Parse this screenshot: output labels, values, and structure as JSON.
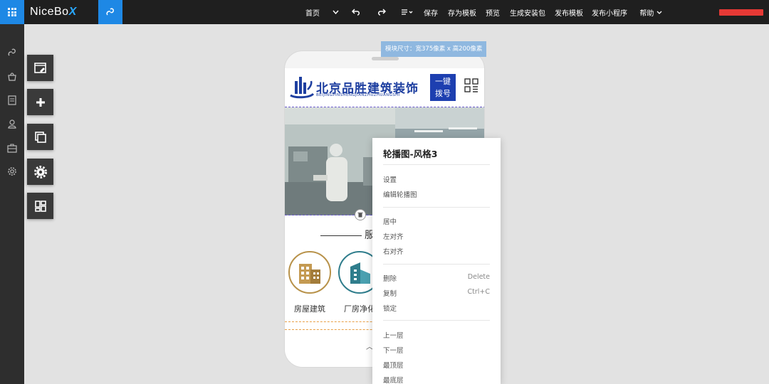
{
  "app": {
    "name_prefix": "NiceBo",
    "name_x": "X"
  },
  "topnav": {
    "items": [
      {
        "label": "首页"
      },
      {
        "label": "保存"
      },
      {
        "label": "存为模板"
      },
      {
        "label": "预览"
      },
      {
        "label": "生成安装包"
      },
      {
        "label": "发布模板"
      },
      {
        "label": "发布小程序"
      },
      {
        "label": "帮助"
      }
    ]
  },
  "module_size_tip": "模块尺寸：宽375像素 x 高200像素",
  "phone": {
    "brand_cn": "北京品胜建筑装饰",
    "brand_en": "BEIJINGPINSHENGJIANZHUZHUANGSHI",
    "call_button": {
      "line1": "一键",
      "line2": "拨号"
    },
    "section_title": "服",
    "services": [
      {
        "label": "房屋建筑"
      },
      {
        "label": "厂房净化"
      }
    ]
  },
  "context_menu": {
    "title": "轮播图-风格3",
    "groups": [
      [
        {
          "label": "设置",
          "shortcut": ""
        },
        {
          "label": "编辑轮播图",
          "shortcut": ""
        }
      ],
      [
        {
          "label": "居中",
          "shortcut": ""
        },
        {
          "label": "左对齐",
          "shortcut": ""
        },
        {
          "label": "右对齐",
          "shortcut": ""
        }
      ],
      [
        {
          "label": "删除",
          "shortcut": "Delete"
        },
        {
          "label": "复制",
          "shortcut": "Ctrl+C"
        },
        {
          "label": "锁定",
          "shortcut": ""
        }
      ],
      [
        {
          "label": "上一层",
          "shortcut": ""
        },
        {
          "label": "下一层",
          "shortcut": ""
        },
        {
          "label": "最顶层",
          "shortcut": ""
        },
        {
          "label": "最底层",
          "shortcut": ""
        }
      ]
    ]
  },
  "colors": {
    "accent": "#1e88e5",
    "brand_blue": "#1d3fb0",
    "user_status": "#e53935"
  }
}
